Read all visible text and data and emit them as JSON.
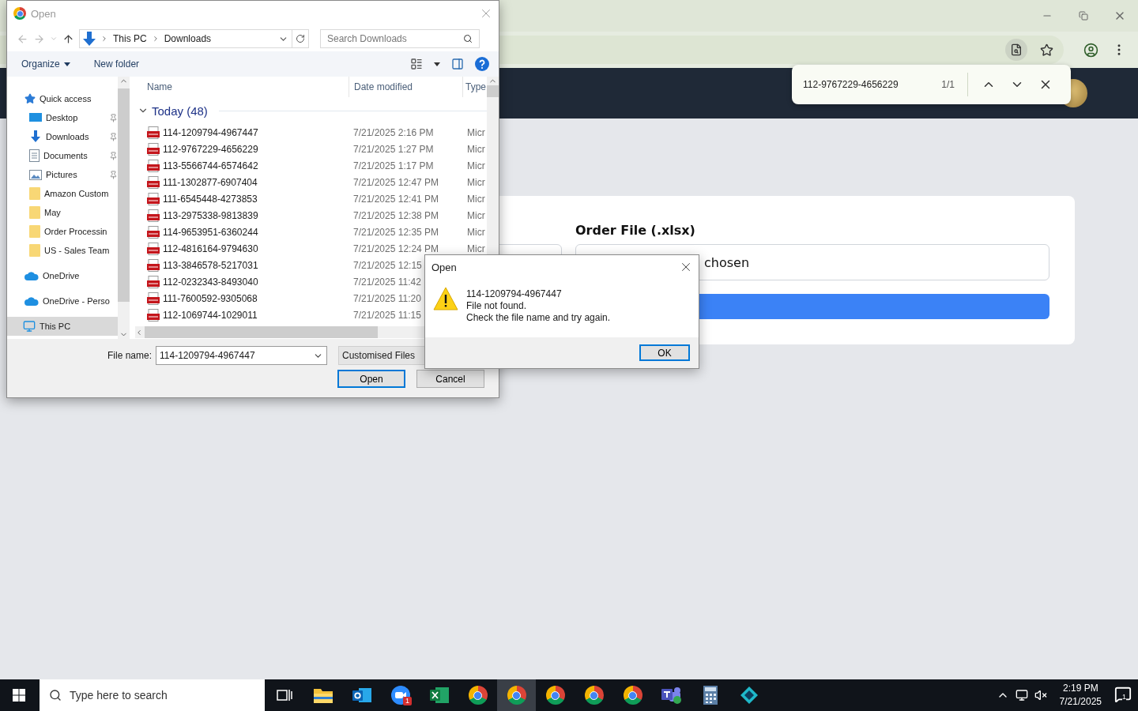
{
  "browser": {
    "find_bar": {
      "query": "112-9767229-4656229",
      "count": "1/1"
    }
  },
  "page": {
    "order_file": {
      "label": "Order File (.xlsx)",
      "status": "chosen"
    }
  },
  "file_dialog": {
    "title": "Open",
    "breadcrumb": [
      "This PC",
      "Downloads"
    ],
    "search": {
      "placeholder": "Search Downloads"
    },
    "toolbar": {
      "organize": "Organize",
      "new_folder": "New folder"
    },
    "nav": [
      {
        "label": "Quick access",
        "kind": "quick",
        "selected": false,
        "children": [
          {
            "label": "Desktop",
            "kind": "desktop",
            "pinned": true,
            "selected": false
          },
          {
            "label": "Downloads",
            "kind": "downloads",
            "pinned": true,
            "selected": false
          },
          {
            "label": "Documents",
            "kind": "documents",
            "pinned": true,
            "selected": false
          },
          {
            "label": "Pictures",
            "kind": "pictures",
            "pinned": true,
            "selected": false
          },
          {
            "label": "Amazon Custom",
            "kind": "folder",
            "pinned": false,
            "selected": false
          },
          {
            "label": "May",
            "kind": "folder",
            "pinned": false,
            "selected": false
          },
          {
            "label": "Order Processin",
            "kind": "folder",
            "pinned": false,
            "selected": false
          },
          {
            "label": "US - Sales Team",
            "kind": "folder",
            "pinned": false,
            "selected": false
          }
        ]
      },
      {
        "label": "OneDrive",
        "kind": "cloud",
        "selected": false
      },
      {
        "label": "OneDrive - Perso",
        "kind": "cloud",
        "selected": false
      },
      {
        "label": "This PC",
        "kind": "pc",
        "selected": true
      }
    ],
    "columns": [
      "Name",
      "Date modified",
      "Type"
    ],
    "group": "Today (48)",
    "files": [
      {
        "name": "114-1209794-4967447",
        "date": "7/21/2025 2:16 PM",
        "type": "Micr"
      },
      {
        "name": "112-9767229-4656229",
        "date": "7/21/2025 1:27 PM",
        "type": "Micr"
      },
      {
        "name": "113-5566744-6574642",
        "date": "7/21/2025 1:17 PM",
        "type": "Micr"
      },
      {
        "name": "111-1302877-6907404",
        "date": "7/21/2025 12:47 PM",
        "type": "Micr"
      },
      {
        "name": "111-6545448-4273853",
        "date": "7/21/2025 12:41 PM",
        "type": "Micr"
      },
      {
        "name": "113-2975338-9813839",
        "date": "7/21/2025 12:38 PM",
        "type": "Micr"
      },
      {
        "name": "114-9653951-6360244",
        "date": "7/21/2025 12:35 PM",
        "type": "Micr"
      },
      {
        "name": "112-4816164-9794630",
        "date": "7/21/2025 12:24 PM",
        "type": "Micr"
      },
      {
        "name": "113-3846578-5217031",
        "date": "7/21/2025 12:15"
      },
      {
        "name": "112-0232343-8493040",
        "date": "7/21/2025 11:42"
      },
      {
        "name": "111-7600592-9305068",
        "date": "7/21/2025 11:20"
      },
      {
        "name": "112-1069744-1029011",
        "date": "7/21/2025 11:15"
      }
    ],
    "file_name_label": "File name:",
    "file_name": "114-1209794-4967447",
    "file_type": "Customised Files",
    "open_button": "Open",
    "cancel_button": "Cancel"
  },
  "error_dialog": {
    "title": "Open",
    "lines": [
      "114-1209794-4967447",
      "File not found.",
      "Check the file name and try again."
    ],
    "button": "OK"
  },
  "taskbar": {
    "search_placeholder": "Type here to search",
    "apps": [
      {
        "kind": "taskview",
        "selected": false
      },
      {
        "kind": "explorer",
        "selected": false
      },
      {
        "kind": "outlook",
        "selected": false
      },
      {
        "kind": "zoom",
        "selected": false,
        "badge": "1"
      },
      {
        "kind": "excel",
        "selected": false
      },
      {
        "kind": "chrome",
        "selected": false
      },
      {
        "kind": "chrome",
        "selected": true
      },
      {
        "kind": "chrome",
        "selected": false
      },
      {
        "kind": "chrome",
        "selected": false
      },
      {
        "kind": "chrome",
        "selected": false
      },
      {
        "kind": "teams",
        "selected": false
      },
      {
        "kind": "calculator",
        "selected": false
      },
      {
        "kind": "app",
        "selected": false
      }
    ],
    "time": "2:19 PM",
    "date": "7/21/2025",
    "notifications": "1"
  }
}
